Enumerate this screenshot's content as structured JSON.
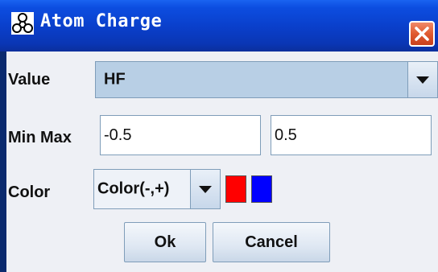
{
  "window": {
    "title": "Atom Charge",
    "title_icon": "molecule-icon",
    "close_icon": "close-icon"
  },
  "value": {
    "label": "Value",
    "selected": "HF"
  },
  "minmax": {
    "label": "Min Max",
    "min": "-0.5",
    "max": "0.5"
  },
  "color": {
    "label": "Color",
    "selected": "Color(-,+)",
    "negative_color": "#ff0000",
    "positive_color": "#0000ff"
  },
  "buttons": {
    "ok": "Ok",
    "cancel": "Cancel"
  }
}
